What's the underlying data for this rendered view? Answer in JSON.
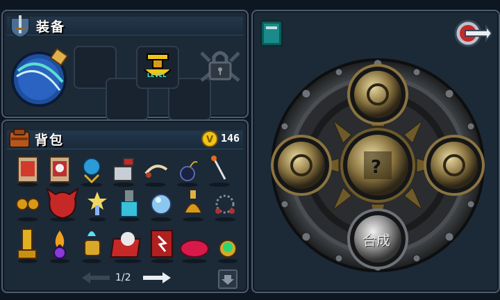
{
  "equipment": {
    "title": "装备",
    "slots": [
      "bomb-weapon",
      "empty",
      "empty",
      "gold-amulet-level",
      "empty",
      "locked"
    ],
    "amulet_label": "LEVEL"
  },
  "backpack": {
    "title": "背包",
    "gold": "146",
    "gold_symbol": "V",
    "page": "1/2",
    "items": [
      "red-potion-card",
      "skull-card",
      "blue-orb-stand",
      "hammer-block",
      "claw-necklace",
      "black-bomb",
      "flame-staff",
      "goggles",
      "red-demon-helm",
      "star-fairy",
      "cyan-potion-statue",
      "crystal-ball-mirror",
      "golden-claw",
      "spiked-chain",
      "golden-trophy",
      "purple-flame-ring",
      "blue-flame-gauntlet",
      "broken-red-tome",
      "red-spellbook",
      "red-slime-blob",
      "green-gem-ring"
    ]
  },
  "crafting": {
    "center_symbol": "?",
    "synth_label": "合成"
  },
  "colors": {
    "panel_bg": "#1c2937",
    "panel_border": "#4e5c6c",
    "gold": "#f0c419",
    "accent_red": "#c62828"
  }
}
